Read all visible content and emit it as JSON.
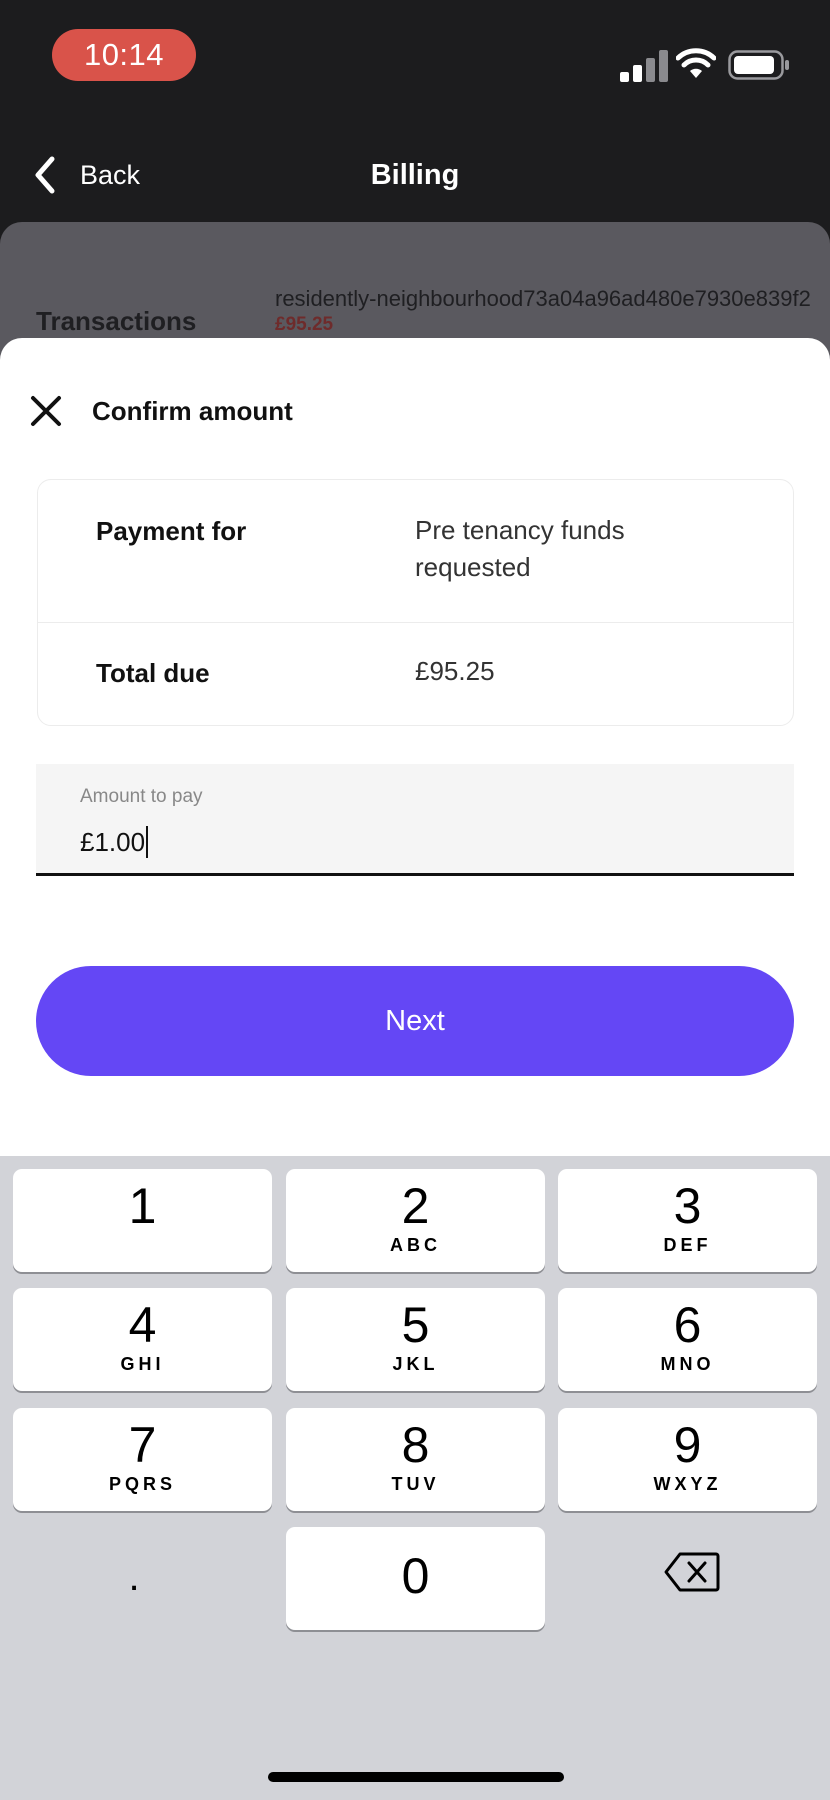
{
  "status_bar": {
    "time": "10:14",
    "icons": [
      "signal-icon",
      "wifi-icon",
      "battery-icon"
    ]
  },
  "nav": {
    "back_label": "Back",
    "title": "Billing"
  },
  "background_page": {
    "transactions_label": "Transactions",
    "reference": "residently-neighbourhood73a04a96ad480e7930e839f2",
    "amount": "£95.25"
  },
  "sheet": {
    "title": "Confirm amount",
    "summary": {
      "payment_for_label": "Payment for",
      "payment_for_value": "Pre tenancy funds requested",
      "total_due_label": "Total due",
      "total_due_value": "£95.25"
    },
    "amount_field": {
      "label": "Amount to pay",
      "value": "£1.00"
    },
    "next_label": "Next"
  },
  "keypad": {
    "keys": [
      {
        "digit": "1",
        "letters": ""
      },
      {
        "digit": "2",
        "letters": "ABC"
      },
      {
        "digit": "3",
        "letters": "DEF"
      },
      {
        "digit": "4",
        "letters": "GHI"
      },
      {
        "digit": "5",
        "letters": "JKL"
      },
      {
        "digit": "6",
        "letters": "MNO"
      },
      {
        "digit": "7",
        "letters": "PQRS"
      },
      {
        "digit": "8",
        "letters": "TUV"
      },
      {
        "digit": "9",
        "letters": "WXYZ"
      },
      {
        "digit": "0",
        "letters": ""
      }
    ],
    "decimal": "."
  },
  "colors": {
    "accent": "#6447f5",
    "time_pill": "#d9534a",
    "header_bg": "#1c1c1e",
    "keypad_bg": "#d2d3d8"
  }
}
